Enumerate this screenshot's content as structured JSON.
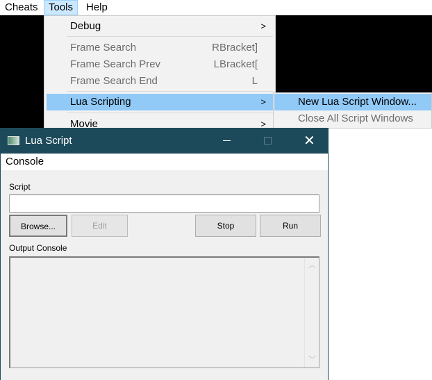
{
  "menubar": {
    "items": [
      "Cheats",
      "Tools",
      "Help"
    ]
  },
  "tools_menu": {
    "items": [
      {
        "label": "Debug",
        "submenu": true
      },
      {
        "label": "Frame Search",
        "shortcut": "RBracket]",
        "disabled": true
      },
      {
        "label": "Frame Search Prev",
        "shortcut": "LBracket[",
        "disabled": true
      },
      {
        "label": "Frame Search End",
        "shortcut": "L",
        "disabled": true
      },
      {
        "label": "Lua Scripting",
        "submenu": true,
        "highlighted": true
      },
      {
        "label": "Movie",
        "submenu": true
      }
    ]
  },
  "lua_submenu": {
    "items": [
      {
        "label": "New Lua Script Window...",
        "highlighted": true
      },
      {
        "label": "Close All Script Windows",
        "disabled": true
      }
    ]
  },
  "window": {
    "title": "Lua Script",
    "menu": "Console",
    "script_label": "Script",
    "script_value": "",
    "buttons": {
      "browse": "Browse...",
      "edit": "Edit",
      "stop": "Stop",
      "run": "Run"
    },
    "output_label": "Output Console",
    "output_value": ""
  },
  "colors": {
    "titlebar": "#1d4a5a",
    "highlight": "#91c9f7"
  }
}
